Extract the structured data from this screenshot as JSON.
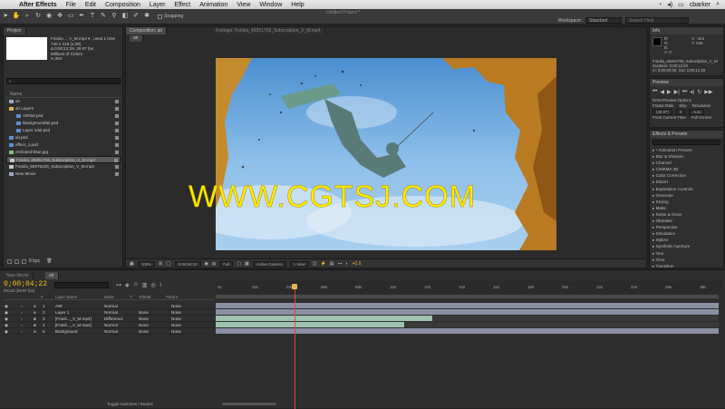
{
  "menubar": {
    "app_name": "After Effects",
    "items": [
      "File",
      "Edit",
      "Composition",
      "Layer",
      "Effect",
      "Animation",
      "View",
      "Window",
      "Help"
    ],
    "user": "cbarker"
  },
  "window_title": "Untitled Project *",
  "toolbar": {
    "snapping_label": "Snapping"
  },
  "workspace": {
    "label": "Workspace:",
    "value": "Standard",
    "search_placeholder": "Search Help"
  },
  "project": {
    "tab": "Project",
    "selected_name": "Fotolia ... V_M.mp4 ▾ , used 1 time",
    "info_lines": [
      "740 x 418 (1.00)",
      "Δ 0;00;12;29, 29.97 fps",
      "Millions of Colors",
      "H.264"
    ],
    "columns": [
      "Name"
    ],
    "items": [
      {
        "name": "air",
        "indent": 0,
        "type": "comp"
      },
      {
        "name": "air Layers",
        "indent": 0,
        "type": "folder"
      },
      {
        "name": "AIR/air.psd",
        "indent": 1,
        "type": "psd"
      },
      {
        "name": "Background/air.psd",
        "indent": 1,
        "type": "psd"
      },
      {
        "name": "Layer 1/air.psd",
        "indent": 1,
        "type": "psd"
      },
      {
        "name": "air.psd",
        "indent": 0,
        "type": "psd"
      },
      {
        "name": "effect_1.psd",
        "indent": 0,
        "type": "psd"
      },
      {
        "name": "enclosed-blue.jpg",
        "indent": 0,
        "type": "img"
      },
      {
        "name": "Fotolia_48251709_Subscription_V_M.mp4",
        "indent": 0,
        "type": "video",
        "selected": true
      },
      {
        "name": "Fotolia_59075226_Subscription_V_M.mp4",
        "indent": 0,
        "type": "video"
      },
      {
        "name": "New Movie",
        "indent": 0,
        "type": "comp"
      }
    ],
    "bpc": "8 bpc"
  },
  "composition": {
    "tab_label": "Composition: air",
    "footage_tab": "Footage: Fotolia_48251709_Subscription_V_M.mp4",
    "breadcrumb": "air",
    "watermark": "WWW.CGTSJ.COM",
    "footer": {
      "zoom": "100%",
      "timecode": "0;00;04;22",
      "resolution": "Full",
      "camera": "Active Camera",
      "views": "1 View",
      "exposure": "+0.0"
    }
  },
  "info": {
    "tab": "Info",
    "x": "X: -124",
    "y": "Y: 340",
    "channels": [
      "R:",
      "G:",
      "B:",
      "A: 0"
    ],
    "file": "Fotolia_48251709_Subscription_V_M",
    "duration": "Duration: 0;00;12;29",
    "in_out": "In: 0;00;00;00, Out: 0;00;12;28"
  },
  "preview": {
    "tab": "Preview",
    "ram_options": "RAM Preview Options",
    "frame_rate_label": "Frame Rate",
    "skip_label": "Skip",
    "resolution_label": "Resolution",
    "frame_rate": "(29.97)",
    "skip": "0",
    "resolution": "Auto",
    "from_current": "From Current Time",
    "full_screen": "Full Screen"
  },
  "effects": {
    "tab": "Effects & Presets",
    "items": [
      "* Animation Presets",
      "Blur & Sharpen",
      "Channel",
      "CINEMA 4D",
      "Color Correction",
      "Distort",
      "Expression Controls",
      "Generate",
      "Keying",
      "Matte",
      "Noise & Grain",
      "Obsolete",
      "Perspective",
      "Simulation",
      "Stylize",
      "Synthetic Aperture",
      "Text",
      "Time",
      "Transition"
    ]
  },
  "timeline": {
    "tabs": [
      "New Movie",
      "air"
    ],
    "timecode": "0;00;04;22",
    "fps": "00142 (29.97 fps)",
    "columns": [
      "#",
      "Layer Name",
      "Mode",
      "T",
      "TrkMat",
      "Parent"
    ],
    "ruler": [
      "0s",
      "02s",
      "04s",
      "06s",
      "08s",
      "10s",
      "12s",
      "14s",
      "16s",
      "18s",
      "20s",
      "22s",
      "24s",
      "26s",
      "28s"
    ],
    "layers": [
      {
        "num": "1",
        "name": "AIR",
        "mode": "Normal",
        "trkmat": "",
        "parent": "None",
        "bar_start": 0.0,
        "bar_end": 1.0,
        "color": "#8a8fa3"
      },
      {
        "num": "2",
        "name": "Layer 1",
        "mode": "Normal",
        "trkmat": "None",
        "parent": "None",
        "bar_start": 0.0,
        "bar_end": 1.0,
        "color": "#8a8fa3"
      },
      {
        "num": "3",
        "name": "[Fotoli..._V_M.mp4]",
        "mode": "Difference",
        "trkmat": "None",
        "parent": "None",
        "bar_start": 0.0,
        "bar_end": 0.43,
        "color": "#9ec3b1"
      },
      {
        "num": "4",
        "name": "[Fotoli..._V_M.mp4]",
        "mode": "Normal",
        "trkmat": "None",
        "parent": "None",
        "bar_start": 0.0,
        "bar_end": 0.375,
        "color": "#9ec3b1"
      },
      {
        "num": "5",
        "name": "Background",
        "mode": "Normal",
        "trkmat": "None",
        "parent": "None",
        "bar_start": 0.0,
        "bar_end": 1.0,
        "color": "#8a8fa3"
      }
    ],
    "playhead_fraction": 0.155,
    "footer": "Toggle Switches / Modes"
  },
  "colors": {
    "timecode": "#f0c000",
    "playhead": "#e2453a",
    "watermark": "#ffec00"
  }
}
